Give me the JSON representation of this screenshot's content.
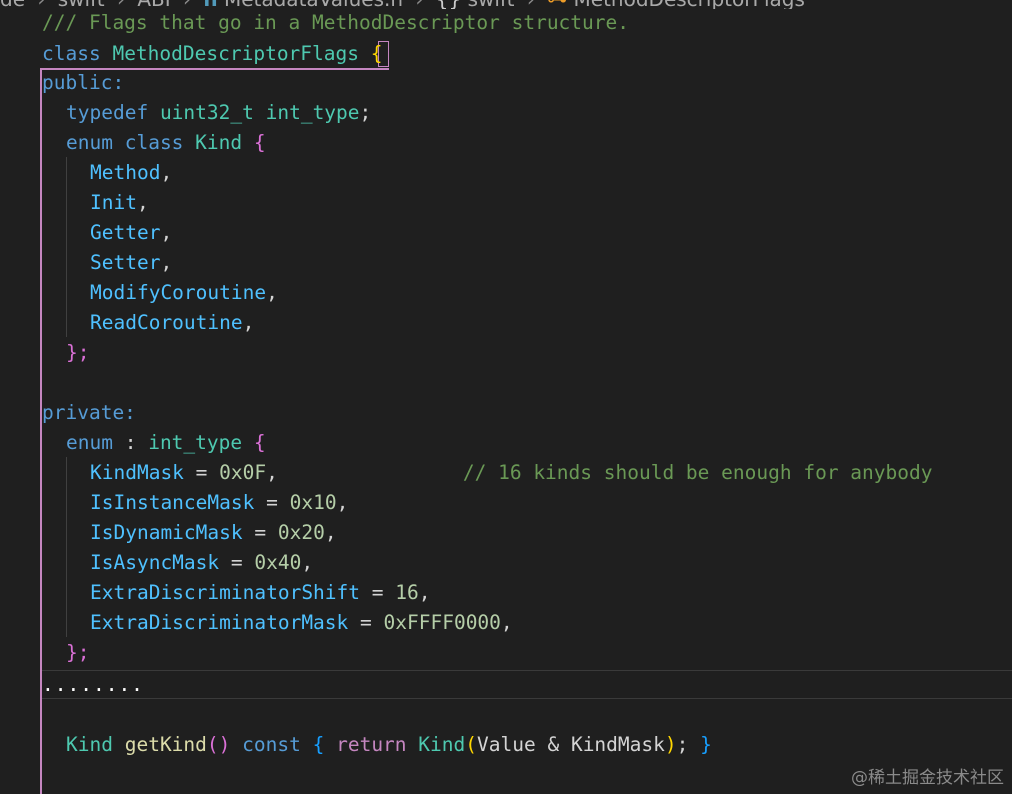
{
  "breadcrumb": {
    "items": [
      "de",
      "swift",
      "ABI",
      "MetadataValues.h",
      "swift",
      "MethodDescriptorFlags"
    ],
    "file_icon": "h-file-icon",
    "namespace_icon": "namespace-braces-icon",
    "class_icon": "class-icon"
  },
  "code": {
    "doc_comment": "/// Flags that go in a MethodDescriptor structure.",
    "kw_class": "class",
    "class_name": "MethodDescriptorFlags",
    "open_brace": "{",
    "public_label": "public:",
    "kw_typedef": "typedef",
    "uint32_t": "uint32_t",
    "int_type": "int_type",
    "semi": ";",
    "kw_enum": "enum",
    "kind_name": "Kind",
    "kind_values": [
      "Method",
      "Init",
      "Getter",
      "Setter",
      "ModifyCoroutine",
      "ReadCoroutine"
    ],
    "comma": ",",
    "close_enum": "};",
    "private_label": "private:",
    "colon": " : ",
    "eq": " = ",
    "mask_names": [
      "KindMask",
      "IsInstanceMask",
      "IsDynamicMask",
      "IsAsyncMask",
      "ExtraDiscriminatorShift",
      "ExtraDiscriminatorMask"
    ],
    "mask_values": [
      "0x0F",
      "0x10",
      "0x20",
      "0x40",
      "16",
      "0xFFFF0000"
    ],
    "kindmask_comment": "// 16 kinds should be enough for anybody",
    "ellipsis": "........",
    "getkind_fn": "getKind",
    "kw_const": "const",
    "kw_return": "return",
    "value_name": "Value",
    "amp": " & "
  },
  "watermark": "@稀土掘金技术社区",
  "colors": {
    "background": "#1f1f1f",
    "keyword": "#569cd6",
    "type": "#4ec9b0",
    "enum_member": "#4fc1ff",
    "number": "#b5cea8",
    "comment": "#6a9955",
    "function": "#dcdcaa",
    "control": "#c586c0",
    "scope_guide": "#c586c0"
  }
}
